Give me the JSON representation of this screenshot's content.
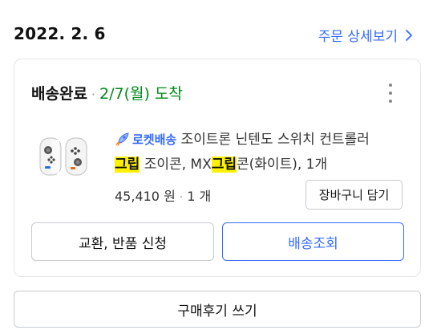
{
  "order": {
    "date": "2022. 2. 6",
    "detail_link_label": "주문 상세보기"
  },
  "card": {
    "status_main": "배송완료",
    "status_separator": "·",
    "status_date": "2/7(월) 도착",
    "product": {
      "badge": "로켓배송",
      "name_part1": "조이트론 닌텐도 스위치 컨트롤러",
      "highlight1": "그립",
      "name_part2": "조이콘, MX",
      "highlight2": "그립",
      "name_part3": "콘(화이트), 1개"
    },
    "price": "45,410 원",
    "price_separator": "·",
    "quantity": "1 개",
    "cart_button_label": "장바구니 담기",
    "exchange_button_label": "교환, 반품 신청",
    "track_button_label": "배송조회"
  },
  "review_button_label": "구매후기 쓰기",
  "colors": {
    "link_blue": "#346aff",
    "status_green": "#00891a",
    "highlight_yellow": "#fff200"
  },
  "icons": [
    "chevron-right-icon",
    "more-vertical-icon",
    "rocket-icon",
    "product-thumbnail"
  ]
}
